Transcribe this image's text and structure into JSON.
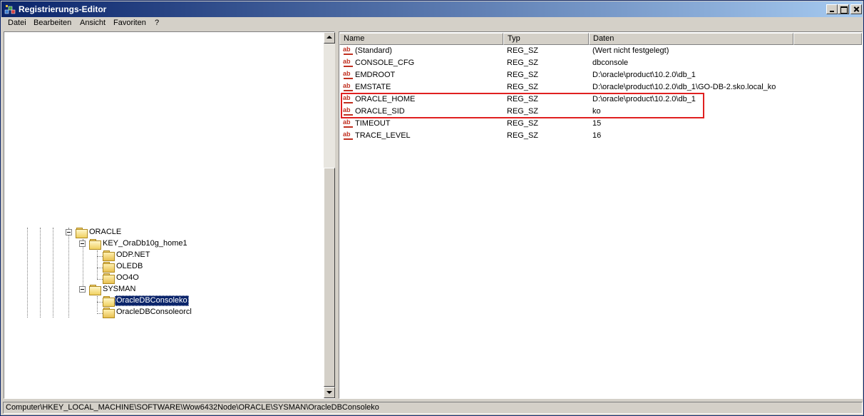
{
  "window": {
    "title": "Registrierungs-Editor"
  },
  "menu": [
    {
      "label": "Datei"
    },
    {
      "label": "Bearbeiten"
    },
    {
      "label": "Ansicht"
    },
    {
      "label": "Favoriten"
    },
    {
      "label": "?"
    }
  ],
  "tree": {
    "nodes": [
      {
        "label": "ORACLE",
        "expanded": true
      },
      {
        "label": "KEY_OraDb10g_home1",
        "expanded": true
      },
      {
        "label": "ODP.NET"
      },
      {
        "label": "OLEDB"
      },
      {
        "label": "OO4O"
      },
      {
        "label": "SYSMAN",
        "expanded": true
      },
      {
        "label": "OracleDBConsoleko",
        "selected": true
      },
      {
        "label": "OracleDBConsoleorcl"
      }
    ]
  },
  "list": {
    "columns": [
      "Name",
      "Typ",
      "Daten"
    ],
    "rows": [
      {
        "name": "(Standard)",
        "type": "REG_SZ",
        "data": "(Wert nicht festgelegt)"
      },
      {
        "name": "CONSOLE_CFG",
        "type": "REG_SZ",
        "data": "dbconsole"
      },
      {
        "name": "EMDROOT",
        "type": "REG_SZ",
        "data": "D:\\oracle\\product\\10.2.0\\db_1"
      },
      {
        "name": "EMSTATE",
        "type": "REG_SZ",
        "data": "D:\\oracle\\product\\10.2.0\\db_1\\GO-DB-2.sko.local_ko"
      },
      {
        "name": "ORACLE_HOME",
        "type": "REG_SZ",
        "data": "D:\\oracle\\product\\10.2.0\\db_1"
      },
      {
        "name": "ORACLE_SID",
        "type": "REG_SZ",
        "data": "ko"
      },
      {
        "name": "TIMEOUT",
        "type": "REG_SZ",
        "data": "15"
      },
      {
        "name": "TRACE_LEVEL",
        "type": "REG_SZ",
        "data": "16"
      }
    ],
    "value_icon": "ab-string-value-icon"
  },
  "status": {
    "path": "Computer\\HKEY_LOCAL_MACHINE\\SOFTWARE\\Wow6432Node\\ORACLE\\SYSMAN\\OracleDBConsoleko"
  },
  "colors": {
    "title_start": "#0a246a",
    "title_end": "#a6caf0",
    "selection": "#0a246a",
    "highlight_border": "#e02020",
    "chrome": "#d4d0c8"
  }
}
